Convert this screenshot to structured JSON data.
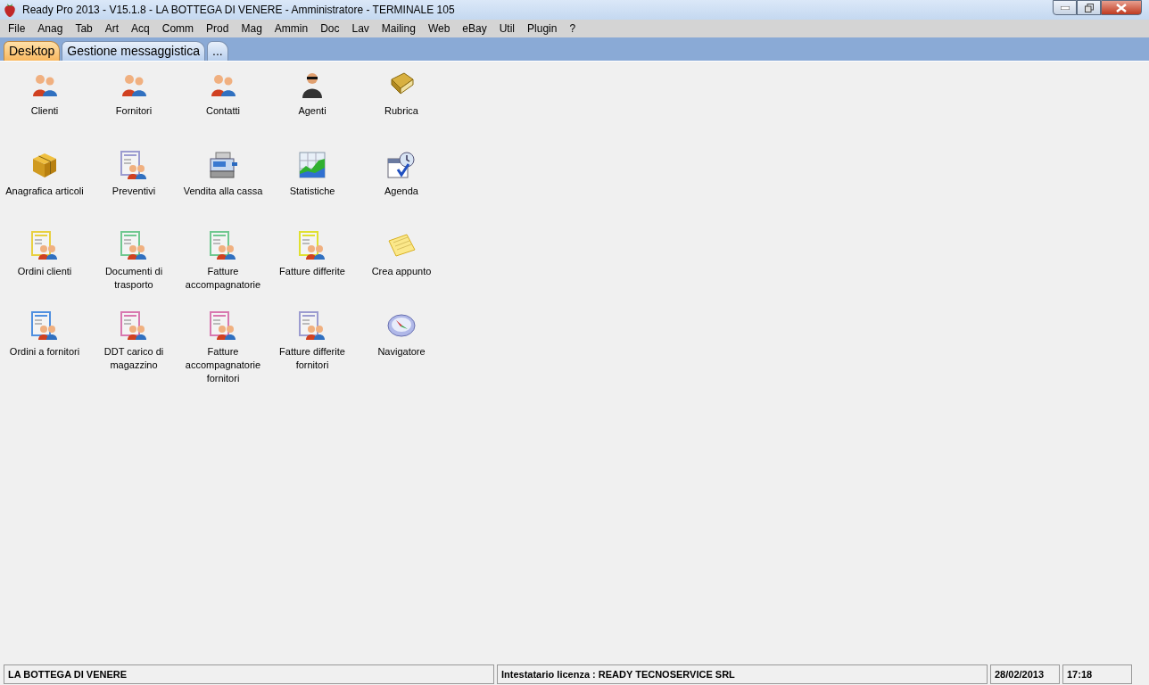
{
  "window": {
    "title": "Ready Pro 2013 - V15.1.8 - LA BOTTEGA DI VENERE - Amministratore - TERMINALE 105"
  },
  "menu": [
    "File",
    "Anag",
    "Tab",
    "Art",
    "Acq",
    "Comm",
    "Prod",
    "Mag",
    "Ammin",
    "Doc",
    "Lav",
    "Mailing",
    "Web",
    "eBay",
    "Util",
    "Plugin",
    "?"
  ],
  "tabs": [
    {
      "label": "Desktop",
      "selected": true
    },
    {
      "label": "Gestione messaggistica",
      "selected": false
    },
    {
      "label": "...",
      "selected": false
    }
  ],
  "desktop_icons": [
    {
      "label": "Clienti",
      "kind": "people"
    },
    {
      "label": "Fornitori",
      "kind": "people"
    },
    {
      "label": "Contatti",
      "kind": "people"
    },
    {
      "label": "Agenti",
      "kind": "person"
    },
    {
      "label": "Rubrica",
      "kind": "book"
    },
    {
      "label": "Anagrafica articoli",
      "kind": "box"
    },
    {
      "label": "Preventivi",
      "kind": "document",
      "color": "#9c9cd0"
    },
    {
      "label": "Vendita alla cassa",
      "kind": "register"
    },
    {
      "label": "Statistiche",
      "kind": "chart"
    },
    {
      "label": "Agenda",
      "kind": "calendar"
    },
    {
      "label": "Ordini clienti",
      "kind": "document",
      "color": "#e8d040"
    },
    {
      "label": "Documenti di trasporto",
      "kind": "document",
      "color": "#70c890"
    },
    {
      "label": "Fatture accompagnatorie",
      "kind": "document",
      "color": "#70c890"
    },
    {
      "label": "Fatture differite",
      "kind": "document",
      "color": "#e0e030"
    },
    {
      "label": "Crea appunto",
      "kind": "note"
    },
    {
      "label": "Ordini a fornitori",
      "kind": "document",
      "color": "#5090e0"
    },
    {
      "label": "DDT carico di magazzino",
      "kind": "document",
      "color": "#d878b0"
    },
    {
      "label": "Fatture accompagnatorie fornitori",
      "kind": "document",
      "color": "#d878b0"
    },
    {
      "label": "Fatture differite fornitori",
      "kind": "document",
      "color": "#9c9cd0"
    },
    {
      "label": "Navigatore",
      "kind": "compass"
    }
  ],
  "status_bar": [
    "LA BOTTEGA DI VENERE",
    "Intestatario licenza : READY TECNOSERVICE SRL",
    "28/02/2013",
    "17:18"
  ]
}
